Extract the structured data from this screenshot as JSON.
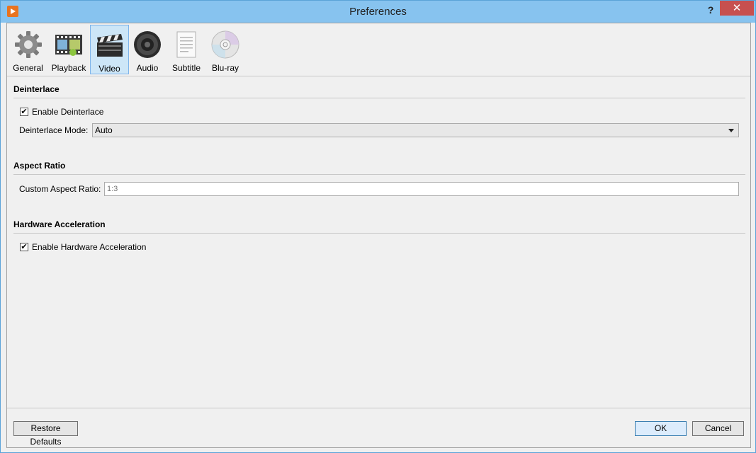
{
  "window": {
    "title": "Preferences",
    "help_glyph": "?",
    "close_glyph": "✕"
  },
  "tabs": [
    {
      "label": "General",
      "icon": "gear-icon",
      "active": false
    },
    {
      "label": "Playback",
      "icon": "film-strip-icon",
      "active": false
    },
    {
      "label": "Video",
      "icon": "clapperboard-icon",
      "active": true
    },
    {
      "label": "Audio",
      "icon": "speaker-icon",
      "active": false
    },
    {
      "label": "Subtitle",
      "icon": "document-icon",
      "active": false
    },
    {
      "label": "Blu-ray",
      "icon": "disc-icon",
      "active": false
    }
  ],
  "deinterlace": {
    "title": "Deinterlace",
    "enable_label": "Enable Deinterlace",
    "enable_checked": true,
    "mode_label": "Deinterlace Mode:",
    "mode_value": "Auto"
  },
  "aspect": {
    "title": "Aspect Ratio",
    "custom_label": "Custom Aspect Ratio:",
    "custom_placeholder": "1:3"
  },
  "hwaccel": {
    "title": "Hardware Acceleration",
    "enable_label": "Enable Hardware Acceleration",
    "enable_checked": true
  },
  "buttons": {
    "restore": "Restore Defaults",
    "ok": "OK",
    "cancel": "Cancel"
  },
  "check_glyph": "✔"
}
